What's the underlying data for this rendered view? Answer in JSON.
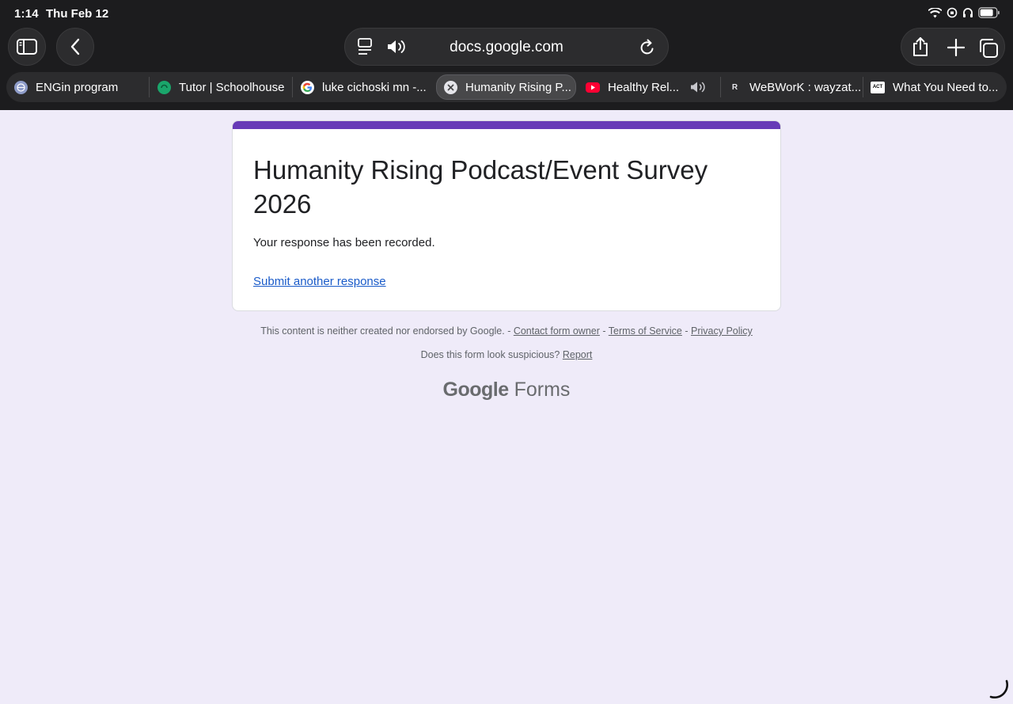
{
  "status_bar": {
    "time": "1:14",
    "date": "Thu Feb 12"
  },
  "address_bar": {
    "url": "docs.google.com"
  },
  "tabs": [
    {
      "title": "ENGin program",
      "favicon": "globe-icon"
    },
    {
      "title": "Tutor | Schoolhouse",
      "favicon": "schoolhouse-icon"
    },
    {
      "title": "luke cichoski mn -...",
      "favicon": "google-icon"
    },
    {
      "title": "Humanity Rising P...",
      "favicon": "close-icon",
      "active": true
    },
    {
      "title": "Healthy Rel...",
      "favicon": "youtube-icon",
      "audio": true
    },
    {
      "title": "WeBWorK : wayzat...",
      "favicon": "R"
    },
    {
      "title": "What You Need to...",
      "favicon": "ACT"
    }
  ],
  "form": {
    "title": "Humanity Rising Podcast/Event Survey 2026",
    "message": "Your response has been recorded.",
    "link": "Submit another response",
    "accent_color": "#673ab7"
  },
  "footer": {
    "disclaimer": "This content is neither created nor endorsed by Google.",
    "sep": " - ",
    "contact": "Contact form owner",
    "terms": "Terms of Service",
    "privacy": "Privacy Policy",
    "suspicious": "Does this form look suspicious?",
    "report": "Report",
    "brand_google": "Google",
    "brand_forms": "Forms"
  }
}
